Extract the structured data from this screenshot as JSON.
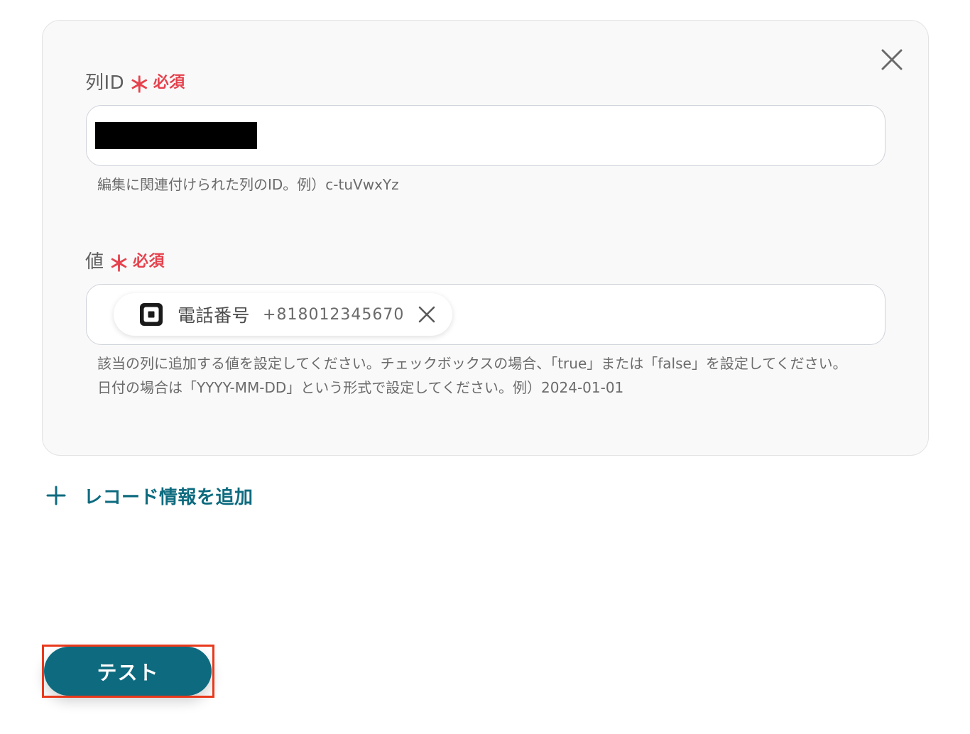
{
  "form": {
    "fields": [
      {
        "label": "列ID",
        "required_mark": "＊",
        "required_text": "必須",
        "value": "",
        "help_lines": [
          "編集に関連付けられた列のID。例）c-tuVwxYz"
        ]
      },
      {
        "label": "値",
        "required_mark": "＊",
        "required_text": "必須",
        "chip": {
          "icon": "square-logo-icon",
          "label": "電話番号",
          "value": "+818012345670"
        },
        "help_lines": [
          "該当の列に追加する値を設定してください。チェックボックスの場合、「true」または「false」を設定してください。",
          "日付の場合は「YYYY-MM-DD」という形式で設定してください。例）2024-01-01"
        ]
      }
    ],
    "add_record_label": "レコード情報を追加"
  },
  "actions": {
    "test_label": "テスト"
  },
  "colors": {
    "accent": "#0e6b7f",
    "required": "#e5424d",
    "highlight": "#e8391c"
  }
}
